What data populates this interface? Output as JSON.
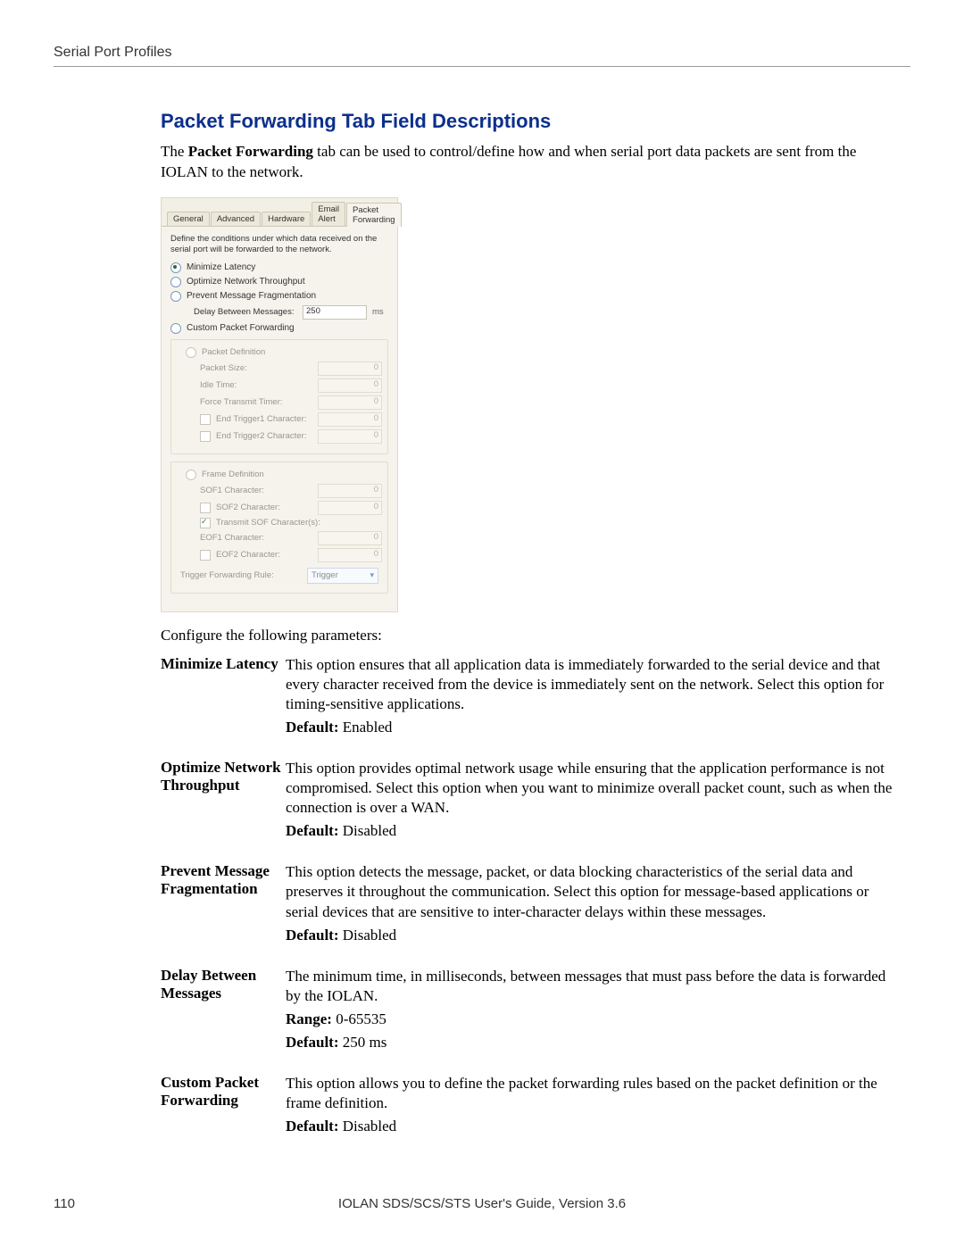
{
  "header": {
    "running_head": "Serial Port Profiles"
  },
  "section": {
    "title": "Packet Forwarding Tab Field Descriptions",
    "intro_pre": "The ",
    "intro_bold": "Packet Forwarding",
    "intro_post": " tab can be used to control/define how and when serial port data packets are sent from the IOLAN to the network."
  },
  "dialog": {
    "tabs": [
      "General",
      "Advanced",
      "Hardware",
      "Email Alert",
      "Packet Forwarding"
    ],
    "active_tab_index": 4,
    "instruction": "Define the conditions under which data received on the serial port will be forwarded to the network.",
    "radios": {
      "minimize_latency": "Minimize Latency",
      "optimize_throughput": "Optimize Network Throughput",
      "prevent_fragmentation": "Prevent Message Fragmentation",
      "custom_forwarding": "Custom Packet Forwarding"
    },
    "delay_between": {
      "label": "Delay Between Messages:",
      "value": "250",
      "unit": "ms"
    },
    "packet_def": {
      "radio_label": "Packet Definition",
      "fields": {
        "packet_size": {
          "label": "Packet Size:",
          "value": "0"
        },
        "idle_time": {
          "label": "Idle Time:",
          "value": "0"
        },
        "force_transmit": {
          "label": "Force Transmit Timer:",
          "value": "0"
        },
        "end_trigger1": {
          "label": "End Trigger1 Character:",
          "value": "0"
        },
        "end_trigger2": {
          "label": "End Trigger2 Character:",
          "value": "0"
        }
      }
    },
    "frame_def": {
      "radio_label": "Frame Definition",
      "fields": {
        "sof1": {
          "label": "SOF1 Character:",
          "value": "0"
        },
        "sof2": {
          "label": "SOF2 Character:",
          "value": "0"
        },
        "transmit_sof": {
          "label": "Transmit SOF Character(s):"
        },
        "eof1": {
          "label": "EOF1 Character:",
          "value": "0"
        },
        "eof2": {
          "label": "EOF2 Character:",
          "value": "0"
        }
      }
    },
    "trigger_rule": {
      "label": "Trigger Forwarding Rule:",
      "value": "Trigger"
    }
  },
  "config_line": "Configure the following parameters:",
  "params": [
    {
      "name": "Minimize Latency",
      "desc": "This option ensures that all application data is immediately forwarded to the serial device and that every character received from the device is immediately sent on the network. Select this option for timing-sensitive applications.",
      "extras": [
        {
          "bold": "Default:",
          "rest": " Enabled"
        }
      ]
    },
    {
      "name": "Optimize Network Throughput",
      "desc": "This option provides optimal network usage while ensuring that the application performance is not compromised. Select this option when you want to minimize overall packet count, such as when the connection is over a WAN.",
      "extras": [
        {
          "bold": "Default:",
          "rest": " Disabled"
        }
      ]
    },
    {
      "name": "Prevent Message Fragmentation",
      "desc": "This option detects the message, packet, or data blocking characteristics of the serial data and preserves it throughout the communication. Select this option for message-based applications or serial devices that are sensitive to inter-character delays within these messages.",
      "extras": [
        {
          "bold": "Default:",
          "rest": " Disabled"
        }
      ]
    },
    {
      "name": "Delay Between Messages",
      "desc": "The minimum time, in milliseconds, between messages that must pass before the data is forwarded by the IOLAN.",
      "extras": [
        {
          "bold": "Range:",
          "rest": " 0-65535"
        },
        {
          "bold": "Default:",
          "rest": " 250 ms"
        }
      ]
    },
    {
      "name": "Custom Packet Forwarding",
      "desc": "This option allows you to define the packet forwarding rules based on the packet definition or the frame definition.",
      "extras": [
        {
          "bold": "Default:",
          "rest": " Disabled"
        }
      ]
    }
  ],
  "footer": {
    "page": "110",
    "center": "IOLAN SDS/SCS/STS User's Guide, Version 3.6"
  }
}
